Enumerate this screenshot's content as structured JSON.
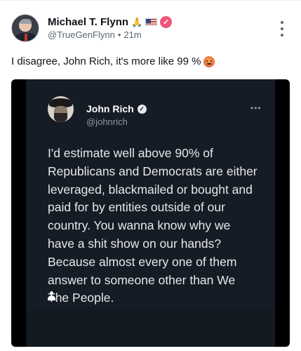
{
  "author": {
    "display_name": "Michael T. Flynn",
    "name_emoji": "🙏",
    "handle": "@TrueGenFlynn",
    "separator": "•",
    "timestamp": "21m"
  },
  "post": {
    "text": "I disagree, John Rich, it's more like 99 %"
  },
  "embedded_tweet": {
    "display_name": "John Rich",
    "handle": "@johnrich",
    "more": "•••",
    "lines": [
      "I'd estimate well above 90% of",
      "Republicans and Democrats are either",
      "leveraged, blackmailed or bought and",
      "paid for by entities outside of our",
      "country. You wanna know why we",
      "have a shit show on our hands?",
      "Because almost every one of them",
      "answer to someone other than We",
      "The People."
    ]
  },
  "icons": {
    "verified": "verified-badge-icon",
    "more": "more-vertical-icon",
    "flag": "us-flag-icon",
    "angry": "angry-face-icon",
    "person": "person-icon"
  },
  "colors": {
    "verified_badge": "#f0557a",
    "media_background": "#000000",
    "embedded_card": "#151c25"
  }
}
